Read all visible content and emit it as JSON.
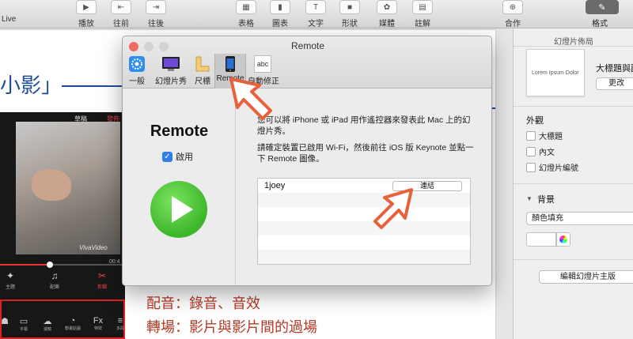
{
  "toolbar": {
    "partial_left_label": "Live",
    "items": [
      {
        "label": "播放",
        "icon": "play-icon"
      },
      {
        "label": "往前",
        "icon": "back-icon"
      },
      {
        "label": "往後",
        "icon": "forward-icon"
      },
      {
        "label": "表格",
        "icon": "table-icon"
      },
      {
        "label": "圖表",
        "icon": "chart-icon"
      },
      {
        "label": "文字",
        "icon": "text-icon"
      },
      {
        "label": "形狀",
        "icon": "shape-icon"
      },
      {
        "label": "媒體",
        "icon": "media-icon"
      },
      {
        "label": "註解",
        "icon": "comment-icon"
      },
      {
        "label": "合作",
        "icon": "collaborate-icon"
      }
    ],
    "format_label": "格式"
  },
  "slide": {
    "title_partial": "小影」",
    "phone": {
      "top_left": "草稿",
      "top_right": "發佈",
      "watermark": "VivaVideo",
      "time": "00:4",
      "progress": 0.39,
      "icons": [
        {
          "label": "主題",
          "icon": "magic-wand-icon"
        },
        {
          "label": "配樂",
          "icon": "music-icon"
        },
        {
          "label": "剪輯",
          "icon": "scissors-icon"
        }
      ],
      "bottom_icons": [
        {
          "label": "",
          "icon": "tool-icon"
        },
        {
          "label": "字幕",
          "icon": "subtitle-icon"
        },
        {
          "label": "濾鏡",
          "icon": "filter-icon"
        },
        {
          "label": "動畫貼圖",
          "icon": "sticker-icon"
        },
        {
          "label": "特效",
          "icon": "fx-icon"
        },
        {
          "label": "多段",
          "icon": "multi-icon"
        }
      ]
    },
    "notes": [
      "配音：錄音、音效",
      "轉場：影片與影片間的過場"
    ]
  },
  "panel": {
    "title": "幻燈片佈局",
    "thumbnail_text": "Lorem Ipsum Dolor",
    "layout_name": "大標題與副",
    "change_button": "更改",
    "appearance_heading": "外觀",
    "checkboxes": [
      "大標題",
      "內文",
      "幻燈片編號"
    ],
    "background_heading": "背景",
    "fill_option": "顏色填充",
    "edit_master_button": "編輯幻燈片主版"
  },
  "window": {
    "title": "Remote",
    "tabs": [
      {
        "label": "一般",
        "icon": "gear-icon"
      },
      {
        "label": "幻燈片秀",
        "icon": "slideshow-icon"
      },
      {
        "label": "尺標",
        "icon": "ruler-icon"
      },
      {
        "label": "Remote",
        "icon": "iphone-icon",
        "selected": true
      },
      {
        "label": "自動修正",
        "icon": "autocorrect-icon"
      }
    ],
    "abc_glyph": "abc",
    "heading": "Remote",
    "enable_label": "啟用",
    "enable_checked": true,
    "description_1": "您可以將 iPhone 或 iPad 用作遙控器來發表此 Mac 上的幻燈片秀。",
    "description_2": "請確定裝置已啟用 Wi-Fi，然後前往 iOS 版 Keynote 並點一下 Remote 圖像。",
    "devices": [
      {
        "name": "1joey",
        "button": "連結"
      }
    ],
    "empty_rows": 5
  },
  "colors": {
    "slide_title": "#1d4c9e",
    "notes": "#b43a26",
    "annotation_arrow": "#e8603c",
    "checkbox_blue": "#2f7fe8",
    "play_green": "#3cb62a"
  }
}
